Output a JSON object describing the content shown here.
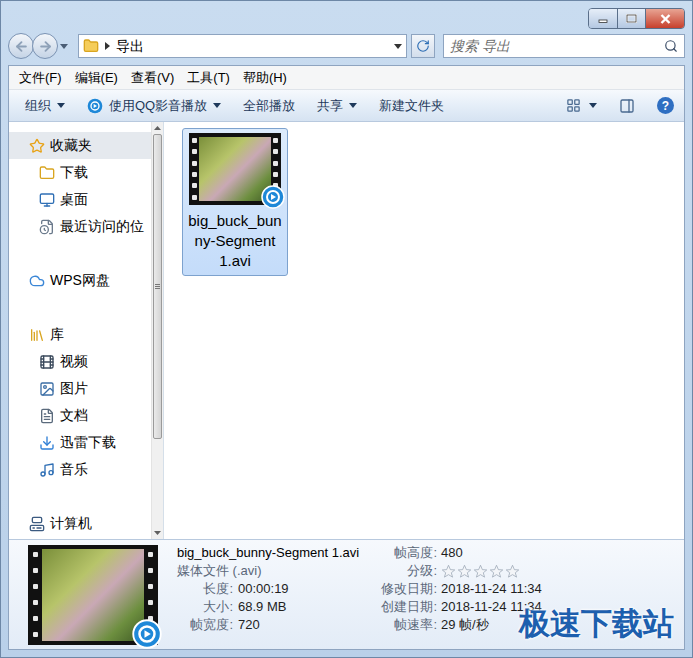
{
  "address": {
    "path": [
      "导出"
    ],
    "search_placeholder": "搜索 导出"
  },
  "menu": [
    "文件(F)",
    "编辑(E)",
    "查看(V)",
    "工具(T)",
    "帮助(H)"
  ],
  "toolbar": [
    {
      "label": "组织",
      "dropdown": true,
      "kind": "plain"
    },
    {
      "label": "使用QQ影音播放",
      "dropdown": true,
      "kind": "app"
    },
    {
      "label": "全部播放",
      "dropdown": false,
      "kind": "plain"
    },
    {
      "label": "共享",
      "dropdown": true,
      "kind": "plain"
    },
    {
      "label": "新建文件夹",
      "dropdown": false,
      "kind": "plain"
    }
  ],
  "help": "?",
  "nav": [
    {
      "label": "收藏夹",
      "kind": "group",
      "selected": true
    },
    {
      "label": "下载",
      "kind": "item",
      "selected": false
    },
    {
      "label": "桌面",
      "kind": "item",
      "selected": false
    },
    {
      "label": "最近访问的位",
      "kind": "item",
      "selected": false
    },
    {
      "label": "WPS网盘",
      "kind": "group",
      "selected": false
    },
    {
      "label": "库",
      "kind": "group",
      "selected": false
    },
    {
      "label": "视频",
      "kind": "item",
      "selected": false
    },
    {
      "label": "图片",
      "kind": "item",
      "selected": false
    },
    {
      "label": "文档",
      "kind": "item",
      "selected": false
    },
    {
      "label": "迅雷下载",
      "kind": "item",
      "selected": false
    },
    {
      "label": "音乐",
      "kind": "item",
      "selected": false
    },
    {
      "label": "计算机",
      "kind": "group",
      "selected": false
    }
  ],
  "files": [
    {
      "name": "big_buck_bunny-Segment 1.avi",
      "selected": true
    }
  ],
  "details": {
    "name": "big_buck_bunny-Segment 1.avi",
    "type": "媒体文件 (.avi)",
    "left_fields": [
      {
        "label": "长度:",
        "value": "00:00:19"
      },
      {
        "label": "大小:",
        "value": "68.9 MB"
      },
      {
        "label": "帧宽度:",
        "value": "720"
      }
    ],
    "right_fields": [
      {
        "label": "帧高度:",
        "value": "480",
        "kind": "text",
        "stars": 0
      },
      {
        "label": "分级:",
        "value": "",
        "kind": "rating",
        "stars": 0
      },
      {
        "label": "修改日期:",
        "value": "2018-11-24 11:34",
        "kind": "text",
        "stars": 0
      },
      {
        "label": "创建日期:",
        "value": "2018-11-24 11:34",
        "kind": "text",
        "stars": 0
      },
      {
        "label": "帧速率:",
        "value": "29 帧/秒",
        "kind": "text",
        "stars": 0
      }
    ]
  },
  "watermark": "极速下载站"
}
